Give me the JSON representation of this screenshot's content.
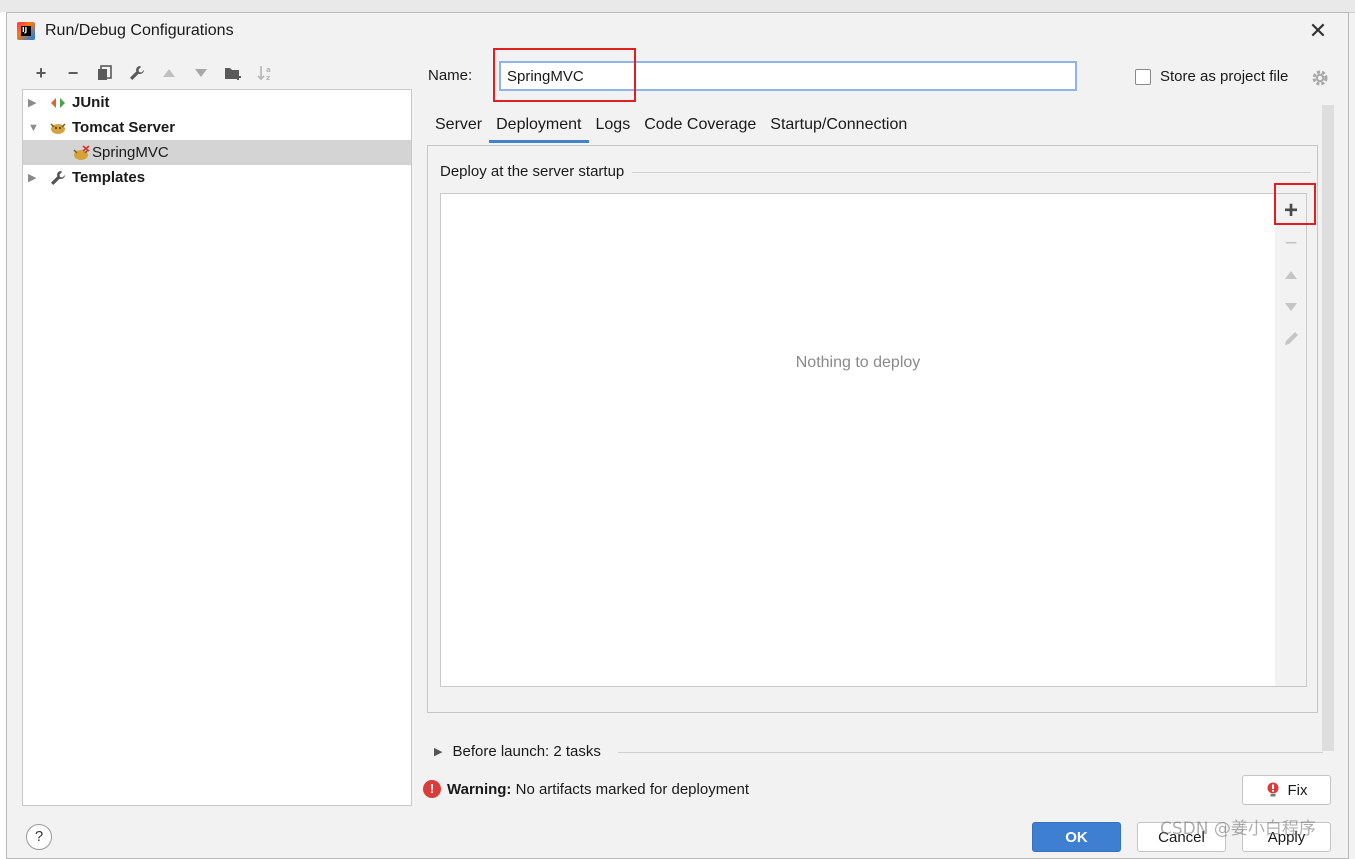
{
  "dialog": {
    "title": "Run/Debug Configurations",
    "close_glyph": "✕"
  },
  "toolbar": {
    "items": [
      {
        "name": "add",
        "glyph": "+"
      },
      {
        "name": "remove",
        "glyph": "−"
      },
      {
        "name": "copy"
      },
      {
        "name": "edit-defaults"
      },
      {
        "name": "move-up"
      },
      {
        "name": "move-down"
      },
      {
        "name": "new-folder"
      },
      {
        "name": "sort"
      }
    ]
  },
  "tree": {
    "items": [
      {
        "label": "JUnit",
        "expanded": false,
        "bold": true,
        "icon": "junit-icon"
      },
      {
        "label": "Tomcat Server",
        "expanded": true,
        "bold": true,
        "icon": "tomcat-icon"
      },
      {
        "label": "SpringMVC",
        "selected": true,
        "bold": false,
        "icon": "tomcat-config-icon"
      },
      {
        "label": "Templates",
        "expanded": false,
        "bold": true,
        "icon": "wrench-icon"
      }
    ]
  },
  "config": {
    "name_label": "Name:",
    "name_value": "SpringMVC",
    "store_label": "Store as project file",
    "store_checked": false
  },
  "tabs": [
    {
      "label": "Server",
      "active": false
    },
    {
      "label": "Deployment",
      "active": true
    },
    {
      "label": "Logs",
      "active": false
    },
    {
      "label": "Code Coverage",
      "active": false
    },
    {
      "label": "Startup/Connection",
      "active": false
    }
  ],
  "deployment": {
    "section_title": "Deploy at the server startup",
    "empty_text": "Nothing to deploy",
    "add_glyph": "+",
    "remove_glyph": "−"
  },
  "before_launch": {
    "label": "Before launch: 2 tasks"
  },
  "warning": {
    "bold": "Warning:",
    "text": " No artifacts marked for deployment",
    "icon_glyph": "!",
    "fix_label": "Fix"
  },
  "buttons": {
    "help": "?",
    "ok": "OK",
    "cancel": "Cancel",
    "apply": "Apply"
  },
  "watermark": "CSDN @姜小白程序",
  "colors": {
    "accent": "#3f7fd1",
    "highlight_box": "#e02020",
    "warning": "#db3b3b"
  }
}
